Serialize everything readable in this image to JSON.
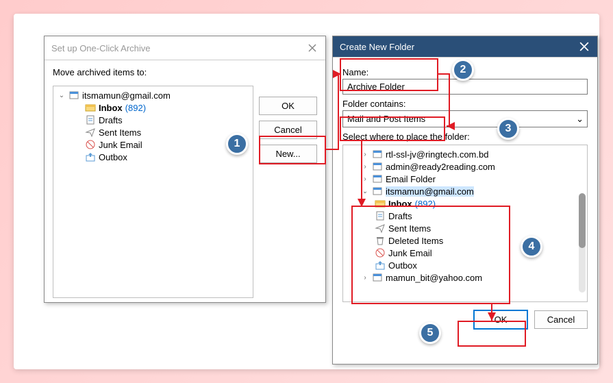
{
  "archive_dialog": {
    "title": "Set up One-Click Archive",
    "label": "Move archived items to:",
    "buttons": {
      "ok": "OK",
      "cancel": "Cancel",
      "new": "New..."
    },
    "tree": {
      "account": "itsmamun@gmail.com",
      "items": [
        {
          "label": "Inbox",
          "count": "(892)",
          "bold": true,
          "icon": "inbox"
        },
        {
          "label": "Drafts",
          "icon": "drafts"
        },
        {
          "label": "Sent Items",
          "icon": "sent"
        },
        {
          "label": "Junk Email",
          "icon": "junk"
        },
        {
          "label": "Outbox",
          "icon": "outbox"
        }
      ]
    }
  },
  "create_dialog": {
    "title": "Create New Folder",
    "name_label": "Name:",
    "name_value": "Archive Folder",
    "contains_label": "Folder contains:",
    "contains_value": "Mail and Post Items",
    "place_label": "Select where to place the folder:",
    "buttons": {
      "ok": "OK",
      "cancel": "Cancel"
    },
    "tree": {
      "top_accounts": [
        "rtl-ssl-jv@ringtech.com.bd",
        "admin@ready2reading.com",
        "Email Folder"
      ],
      "expanded_account": "itsmamun@gmail.com",
      "expanded_items": [
        {
          "label": "Inbox",
          "count": "(892)",
          "bold": true,
          "icon": "inbox"
        },
        {
          "label": "Drafts",
          "icon": "drafts"
        },
        {
          "label": "Sent Items",
          "icon": "sent"
        },
        {
          "label": "Deleted Items",
          "icon": "deleted"
        },
        {
          "label": "Junk Email",
          "icon": "junk"
        },
        {
          "label": "Outbox",
          "icon": "outbox"
        }
      ],
      "bottom_account": "mamun_bit@yahoo.com"
    }
  },
  "callouts": {
    "c1": "1",
    "c2": "2",
    "c3": "3",
    "c4": "4",
    "c5": "5"
  }
}
